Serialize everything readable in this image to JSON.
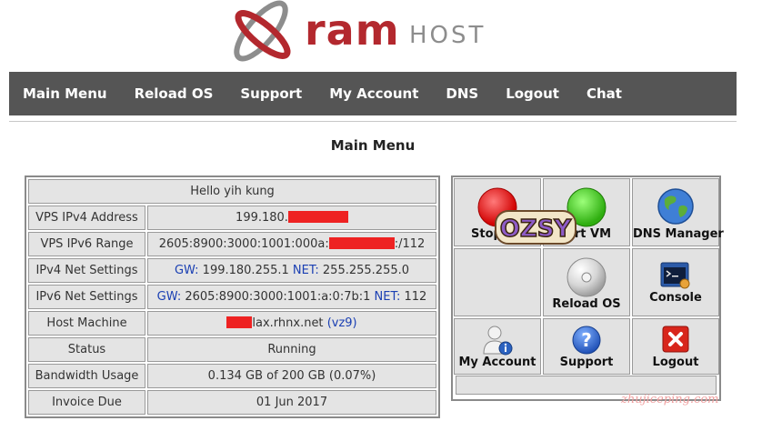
{
  "logo": {
    "ram": "ram",
    "host": "HOST"
  },
  "nav": {
    "items": [
      "Main Menu",
      "Reload OS",
      "Support",
      "My Account",
      "DNS",
      "Logout",
      "Chat"
    ]
  },
  "page_title": "Main Menu",
  "info": {
    "greeting": "Hello yih kung",
    "rows": {
      "ipv4_label": "VPS IPv4 Address",
      "ipv4_value": "199.180.",
      "ipv6_label": "VPS IPv6 Range",
      "ipv6_prefix": "2605:8900:3000:1001:000a:",
      "ipv6_suffix": ":/112",
      "ipv4net_label": "IPv4 Net Settings",
      "ipv4net_gw_key": "GW:",
      "ipv4net_gw": "199.180.255.1",
      "ipv4net_net_key": "NET:",
      "ipv4net_net": "255.255.255.0",
      "ipv6net_label": "IPv6 Net Settings",
      "ipv6net_gw_key": "GW:",
      "ipv6net_gw": "2605:8900:3000:1001:a:0:7b:1",
      "ipv6net_net_key": "NET:",
      "ipv6net_net": "112",
      "host_label": "Host Machine",
      "host_value": "lax.rhnx.net",
      "host_node": "(vz9)",
      "status_label": "Status",
      "status_value": "Running",
      "bw_label": "Bandwidth Usage",
      "bw_value": "0.134 GB of 200 GB (0.07%)",
      "invoice_label": "Invoice Due",
      "invoice_value": "01 Jun 2017"
    }
  },
  "actions": {
    "stop": "Stop",
    "start": "art VM",
    "dns": "DNS Manager",
    "reload": "Reload OS",
    "console": "Console",
    "account": "My Account",
    "support": "Support",
    "logout": "Logout"
  },
  "sticker": "OZSY",
  "watermark": "zhujiceping.com",
  "colors": {
    "nav_bg": "#555555",
    "brand_red": "#b3282e",
    "link_blue": "#1a3fb3",
    "redaction": "#ee2222"
  }
}
